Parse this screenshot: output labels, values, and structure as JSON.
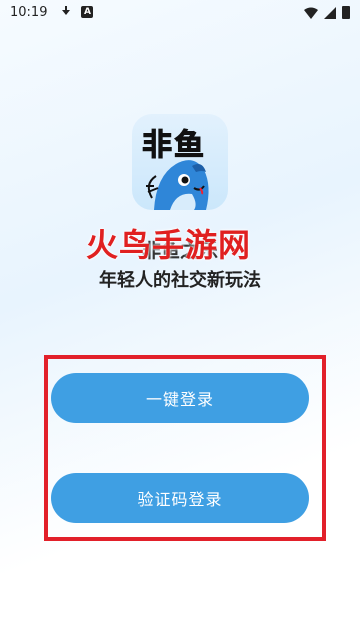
{
  "status_bar": {
    "time": "10:19",
    "a_icon_label": "A"
  },
  "app": {
    "icon_text": "非鱼",
    "name": "非鱼之乐",
    "slogan": "年轻人的社交新玩法"
  },
  "watermark": {
    "text": "火鸟手游网"
  },
  "actions": {
    "one_key_login": "一键登录",
    "code_login": "验证码登录"
  },
  "colors": {
    "primary_button": "#3f9fe3",
    "highlight_border": "#e2202a",
    "watermark": "#e02020"
  }
}
